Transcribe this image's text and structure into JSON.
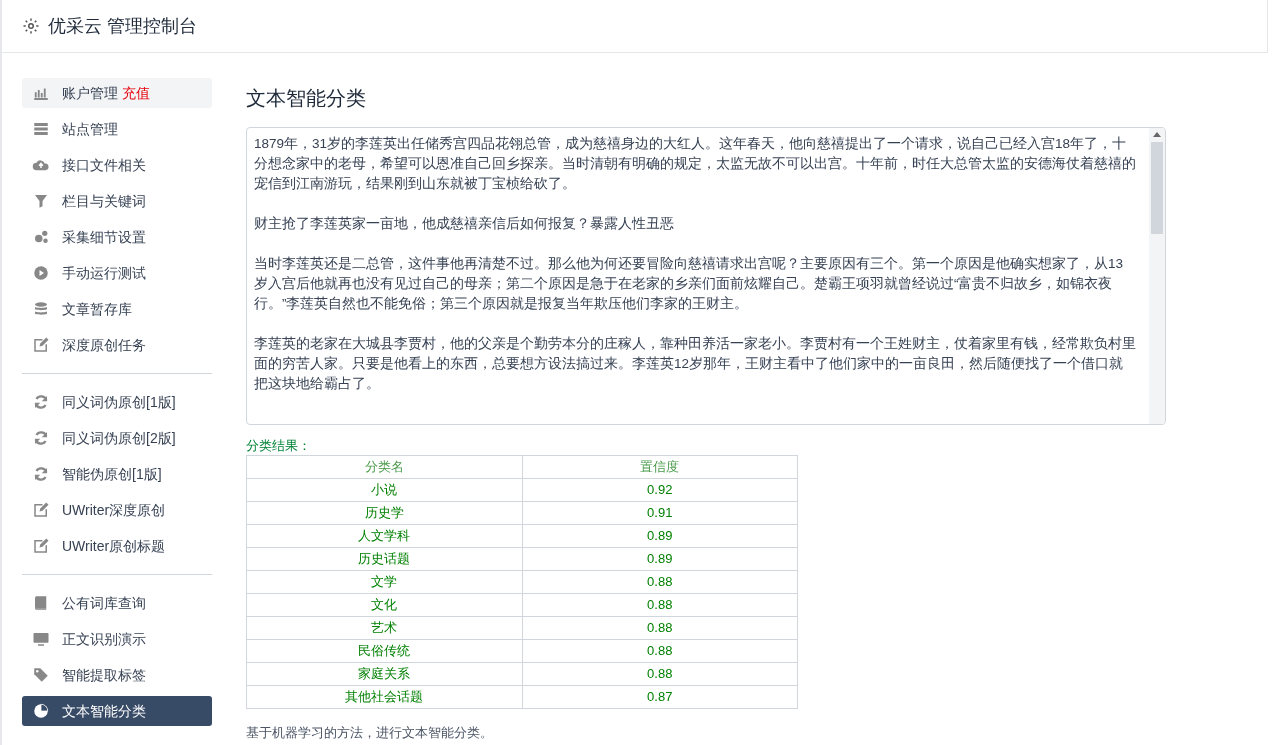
{
  "header": {
    "title": "优采云 管理控制台"
  },
  "sidebar": {
    "groups": [
      {
        "items": [
          {
            "label": "账户管理",
            "badge": "充值",
            "selected": false,
            "highlighted": true
          },
          {
            "label": "站点管理",
            "selected": false,
            "highlighted": false
          },
          {
            "label": "接口文件相关",
            "selected": false,
            "highlighted": false
          },
          {
            "label": "栏目与关键词",
            "selected": false,
            "highlighted": false
          },
          {
            "label": "采集细节设置",
            "selected": false,
            "highlighted": false
          },
          {
            "label": "手动运行测试",
            "selected": false,
            "highlighted": false
          },
          {
            "label": "文章暂存库",
            "selected": false,
            "highlighted": false
          },
          {
            "label": "深度原创任务",
            "selected": false,
            "highlighted": false
          }
        ]
      },
      {
        "items": [
          {
            "label": "同义词伪原创[1版]",
            "selected": false,
            "highlighted": false
          },
          {
            "label": "同义词伪原创[2版]",
            "selected": false,
            "highlighted": false
          },
          {
            "label": "智能伪原创[1版]",
            "selected": false,
            "highlighted": false
          },
          {
            "label": "UWriter深度原创",
            "selected": false,
            "highlighted": false
          },
          {
            "label": "UWriter原创标题",
            "selected": false,
            "highlighted": false
          }
        ]
      },
      {
        "items": [
          {
            "label": "公有词库查询",
            "selected": false,
            "highlighted": false
          },
          {
            "label": "正文识别演示",
            "selected": false,
            "highlighted": false
          },
          {
            "label": "智能提取标签",
            "selected": false,
            "highlighted": false
          },
          {
            "label": "文本智能分类",
            "selected": true,
            "highlighted": false
          }
        ]
      }
    ]
  },
  "main": {
    "title": "文本智能分类",
    "text_input": {
      "paragraphs": [
        "1879年，31岁的李莲英出任储秀宫四品花翎总管，成为慈禧身边的大红人。这年春天，他向慈禧提出了一个请求，说自己已经入宫18年了，十分想念家中的老母，希望可以恩准自己回乡探亲。当时清朝有明确的规定，太监无故不可以出宫。十年前，时任大总管太监的安德海仗着慈禧的宠信到江南游玩，结果刚到山东就被丁宝桢给砍了。",
        "财主抢了李莲英家一亩地，他成慈禧亲信后如何报复？暴露人性丑恶",
        "当时李莲英还是二总管，这件事他再清楚不过。那么他为何还要冒险向慈禧请求出宫呢？主要原因有三个。第一个原因是他确实想家了，从13岁入宫后他就再也没有见过自己的母亲；第二个原因是急于在老家的乡亲们面前炫耀自己。楚霸王项羽就曾经说过“富贵不归故乡，如锦衣夜行。”李莲英自然也不能免俗；第三个原因就是报复当年欺压他们李家的王财主。",
        "李莲英的老家在大城县李贾村，他的父亲是个勤劳本分的庄稼人，靠种田养活一家老小。李贾村有一个王姓财主，仗着家里有钱，经常欺负村里面的穷苦人家。只要是他看上的东西，总要想方设法搞过来。李莲英12岁那年，王财主看中了他们家中的一亩良田，然后随便找了一个借口就把这块地给霸占了。"
      ]
    },
    "result_label": "分类结果：",
    "table": {
      "columns": [
        "分类名",
        "置信度"
      ],
      "rows": [
        [
          "小说",
          "0.92"
        ],
        [
          "历史学",
          "0.91"
        ],
        [
          "人文学科",
          "0.89"
        ],
        [
          "历史话题",
          "0.89"
        ],
        [
          "文学",
          "0.88"
        ],
        [
          "文化",
          "0.88"
        ],
        [
          "艺术",
          "0.88"
        ],
        [
          "民俗传统",
          "0.88"
        ],
        [
          "家庭关系",
          "0.88"
        ],
        [
          "其他社会话题",
          "0.87"
        ]
      ]
    },
    "footnote": "基于机器学习的方法，进行文本智能分类。"
  }
}
